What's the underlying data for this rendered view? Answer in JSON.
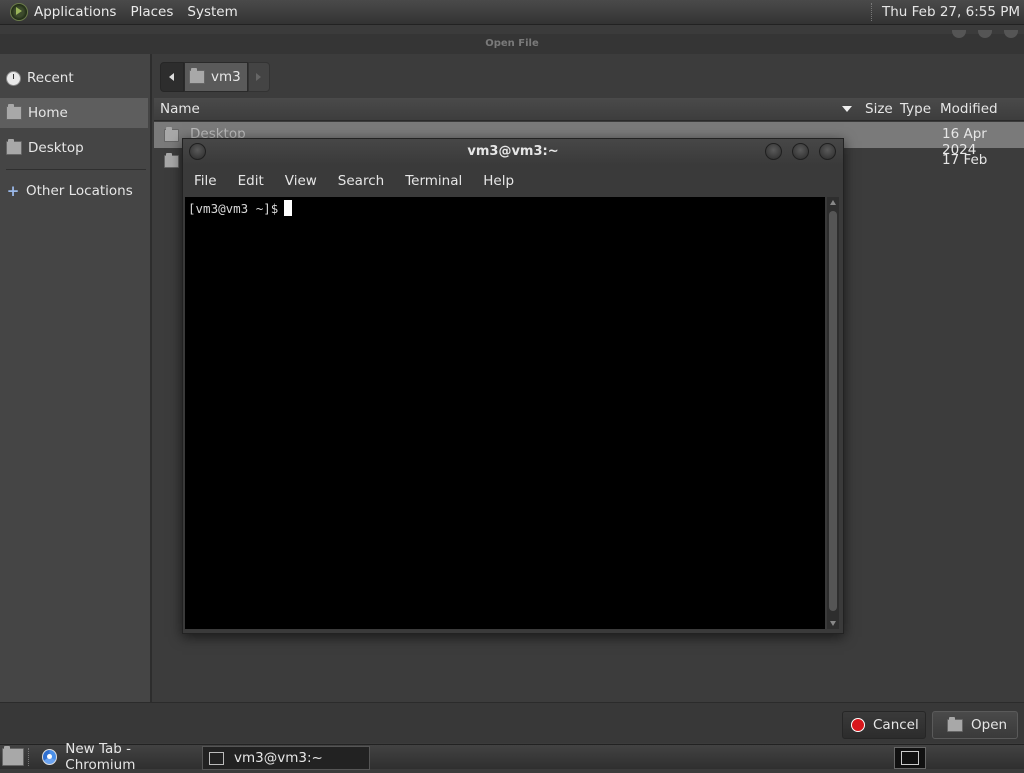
{
  "top_panel": {
    "menus": [
      "Applications",
      "Places",
      "System"
    ],
    "clock": "Thu Feb 27,  6:55 PM"
  },
  "file_chooser": {
    "title": "Open File",
    "sidebar": {
      "items": [
        {
          "label": "Recent",
          "icon": "clock-icon"
        },
        {
          "label": "Home",
          "icon": "home-folder-icon",
          "active": true
        },
        {
          "label": "Desktop",
          "icon": "folder-icon"
        },
        {
          "label": "Other Locations",
          "icon": "plus-icon"
        }
      ]
    },
    "path": {
      "current": "vm3"
    },
    "columns": [
      "Name",
      "Size",
      "Type",
      "Modified"
    ],
    "rows": [
      {
        "name": "Desktop",
        "modified": "16 Apr 2024",
        "selected": true
      },
      {
        "name": "",
        "modified": "17 Feb",
        "selected": false
      }
    ],
    "buttons": {
      "cancel": "Cancel",
      "open": "Open"
    }
  },
  "terminal": {
    "title": "vm3@vm3:~",
    "menus": [
      "File",
      "Edit",
      "View",
      "Search",
      "Terminal",
      "Help"
    ],
    "prompt": "[vm3@vm3 ~]$"
  },
  "taskbar": {
    "tasks": [
      {
        "label": "New Tab - Chromium",
        "icon": "chromium-icon",
        "active": false
      },
      {
        "label": "vm3@vm3:~",
        "icon": "terminal-icon",
        "active": true
      }
    ]
  }
}
